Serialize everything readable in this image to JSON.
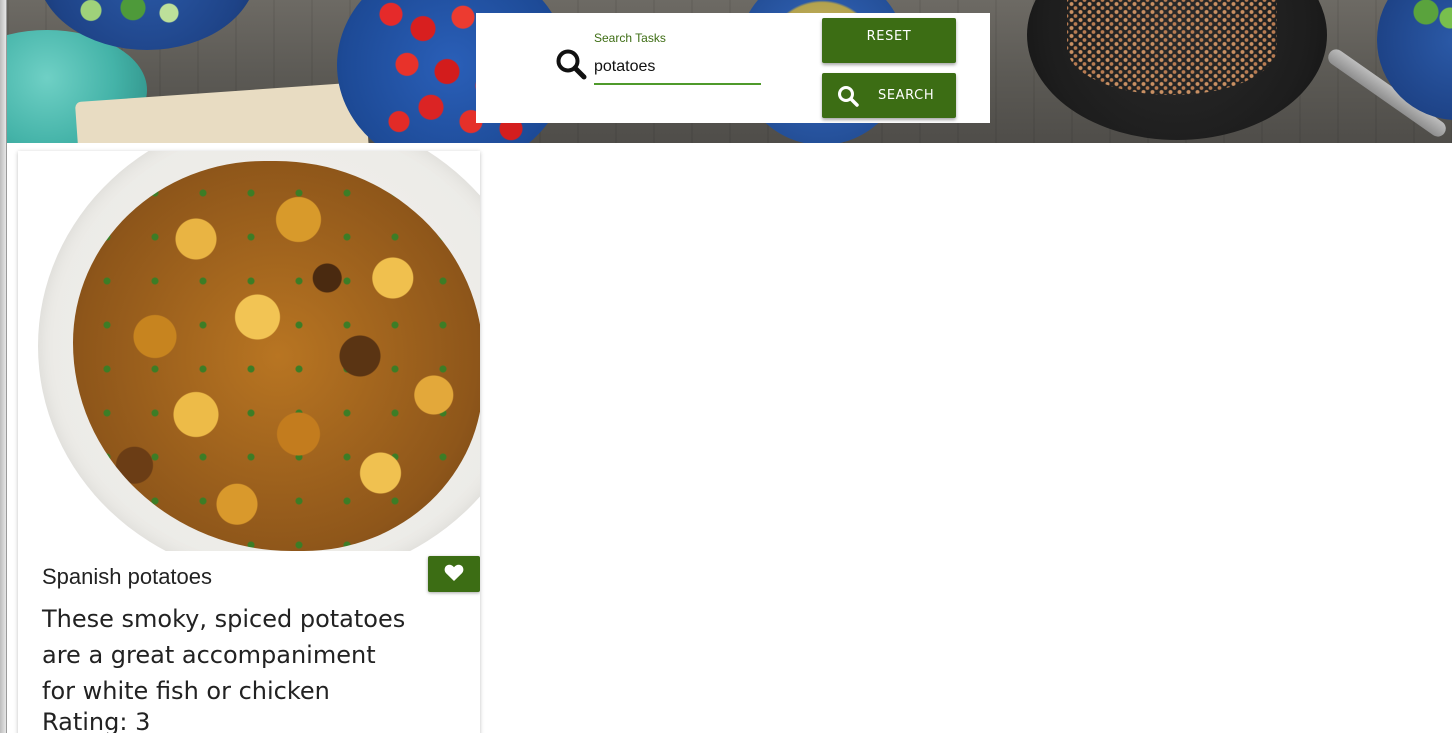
{
  "search": {
    "label": "Search Tasks",
    "value": "potatoes",
    "reset_label": "RESET",
    "search_label": "SEARCH"
  },
  "icons": {
    "field_icon": "search-icon",
    "search_button_icon": "search-icon",
    "favorite_icon": "heart-icon"
  },
  "recipe": {
    "title": "Spanish potatoes",
    "description": "These smoky, spiced potatoes are a great accompaniment for white fish or chicken",
    "rating_label": "Rating:",
    "rating_value": "3"
  },
  "colors": {
    "accent": "#3c6d14",
    "label_green": "#3e6d14",
    "underline_green": "#4f9a2b"
  }
}
